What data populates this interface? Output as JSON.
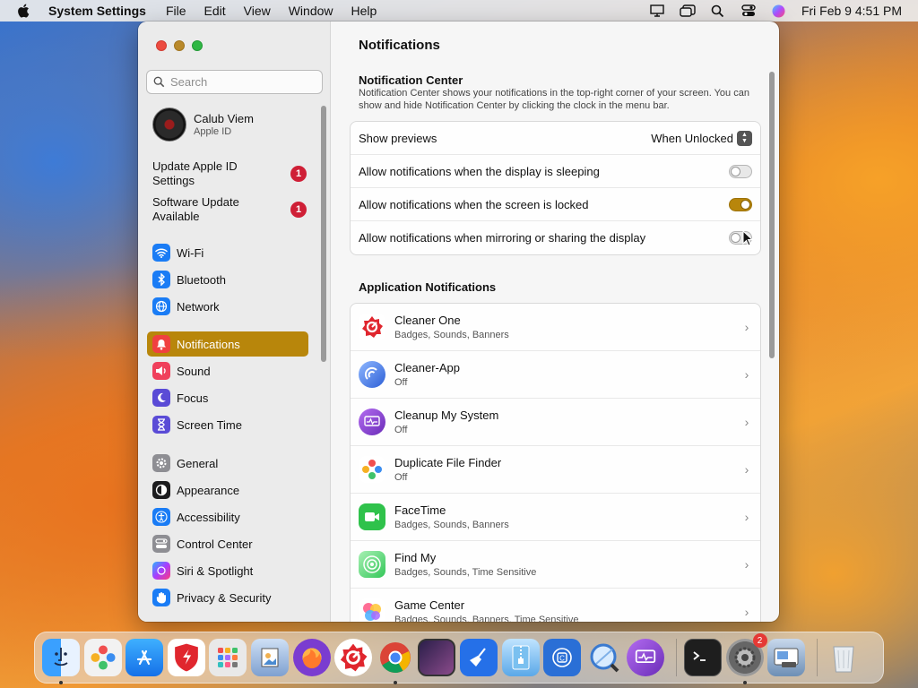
{
  "menubar": {
    "app_name": "System Settings",
    "menus": [
      "File",
      "Edit",
      "View",
      "Window",
      "Help"
    ],
    "clock": "Fri Feb 9  4:51 PM"
  },
  "sidebar": {
    "search_placeholder": "Search",
    "account": {
      "name": "Calub Viem",
      "subtitle": "Apple ID"
    },
    "alerts": [
      {
        "label": "Update Apple ID Settings",
        "badge": "1"
      },
      {
        "label": "Software Update Available",
        "badge": "1"
      }
    ],
    "items": [
      {
        "label": "Wi-Fi",
        "icon": "wifi-icon",
        "color": "#1a7cf5"
      },
      {
        "label": "Bluetooth",
        "icon": "bluetooth-icon",
        "color": "#1a7cf5"
      },
      {
        "label": "Network",
        "icon": "globe-icon",
        "color": "#1a7cf5"
      },
      {
        "label": "Notifications",
        "icon": "bell-icon",
        "color": "#f04040",
        "active": true
      },
      {
        "label": "Sound",
        "icon": "speaker-icon",
        "color": "#f0405c"
      },
      {
        "label": "Focus",
        "icon": "moon-icon",
        "color": "#5a4bd6"
      },
      {
        "label": "Screen Time",
        "icon": "hourglass-icon",
        "color": "#5a4bd6"
      },
      {
        "label": "General",
        "icon": "gear-icon",
        "color": "#8e8e93"
      },
      {
        "label": "Appearance",
        "icon": "appearance-icon",
        "color": "#1c1c1e"
      },
      {
        "label": "Accessibility",
        "icon": "accessibility-icon",
        "color": "#1a7cf5"
      },
      {
        "label": "Control Center",
        "icon": "control-center-icon",
        "color": "#8e8e93"
      },
      {
        "label": "Siri & Spotlight",
        "icon": "siri-icon",
        "color": "#6a3fd0"
      },
      {
        "label": "Privacy & Security",
        "icon": "hand-icon",
        "color": "#1a7cf5"
      }
    ]
  },
  "main": {
    "title": "Notifications",
    "center": {
      "title": "Notification Center",
      "description": "Notification Center shows your notifications in the top-right corner of your screen. You can show and hide Notification Center by clicking the clock in the menu bar.",
      "show_previews_label": "Show previews",
      "show_previews_value": "When Unlocked",
      "toggles": [
        {
          "label": "Allow notifications when the display is sleeping",
          "on": false
        },
        {
          "label": "Allow notifications when the screen is locked",
          "on": true
        },
        {
          "label": "Allow notifications when mirroring or sharing the display",
          "on": false
        }
      ]
    },
    "apps": {
      "title": "Application Notifications",
      "list": [
        {
          "name": "Cleaner One",
          "detail": "Badges, Sounds, Banners",
          "icon": "cleaner-one-icon",
          "color": "#e0262e"
        },
        {
          "name": "Cleaner-App",
          "detail": "Off",
          "icon": "cleaner-app-icon",
          "color": "#3b6fd8"
        },
        {
          "name": "Cleanup My System",
          "detail": "Off",
          "icon": "cleanup-my-system-icon",
          "color": "#7b3fc4"
        },
        {
          "name": "Duplicate File Finder",
          "detail": "Off",
          "icon": "duplicate-file-finder-icon",
          "color": "#ffffff"
        },
        {
          "name": "FaceTime",
          "detail": "Badges, Sounds, Banners",
          "icon": "facetime-icon",
          "color": "#2fc24b"
        },
        {
          "name": "Find My",
          "detail": "Badges, Sounds, Time Sensitive",
          "icon": "find-my-icon",
          "color": "#34c759"
        },
        {
          "name": "Game Center",
          "detail": "Badges, Sounds, Banners, Time Sensitive",
          "icon": "game-center-icon",
          "color": "#ffffff"
        }
      ]
    }
  },
  "dock": {
    "items": [
      {
        "name": "finder-icon",
        "color": "#2f8bf0",
        "running": true
      },
      {
        "name": "duplicate-file-finder-icon",
        "color": "#f2f2f2"
      },
      {
        "name": "app-store-icon",
        "color": "#1f8ef1"
      },
      {
        "name": "cleaner-one-icon",
        "color": "#e0262e"
      },
      {
        "name": "launchpad-icon",
        "color": "#e9e9e9"
      },
      {
        "name": "preview-icon",
        "color": "#6b8cc9"
      },
      {
        "name": "firefox-icon",
        "color": "#7a3cd0"
      },
      {
        "name": "cleaner-one-pro-icon",
        "color": "#e0262e"
      },
      {
        "name": "chrome-icon",
        "color": "#f0f0f0",
        "running": true
      },
      {
        "name": "photo-booth-icon",
        "color": "#3a2a5a"
      },
      {
        "name": "broom-icon",
        "color": "#2570e8"
      },
      {
        "name": "archive-utility-icon",
        "color": "#7ac0f0"
      },
      {
        "name": "disk-utility-icon",
        "color": "#2a6fd6"
      },
      {
        "name": "magnifier-icon",
        "color": "#4a90d9"
      },
      {
        "name": "cleanup-my-system-icon",
        "color": "#8a3fc4"
      },
      {
        "name": "terminal-icon",
        "color": "#1e1e1e",
        "separator_before": true
      },
      {
        "name": "system-settings-icon",
        "color": "#8a8a8a",
        "running": true,
        "badge": "2"
      },
      {
        "name": "screenshot-icon",
        "color": "#6d8fb5"
      },
      {
        "name": "trash-icon",
        "color": "#e2e6ea",
        "separator_before": true
      }
    ]
  }
}
